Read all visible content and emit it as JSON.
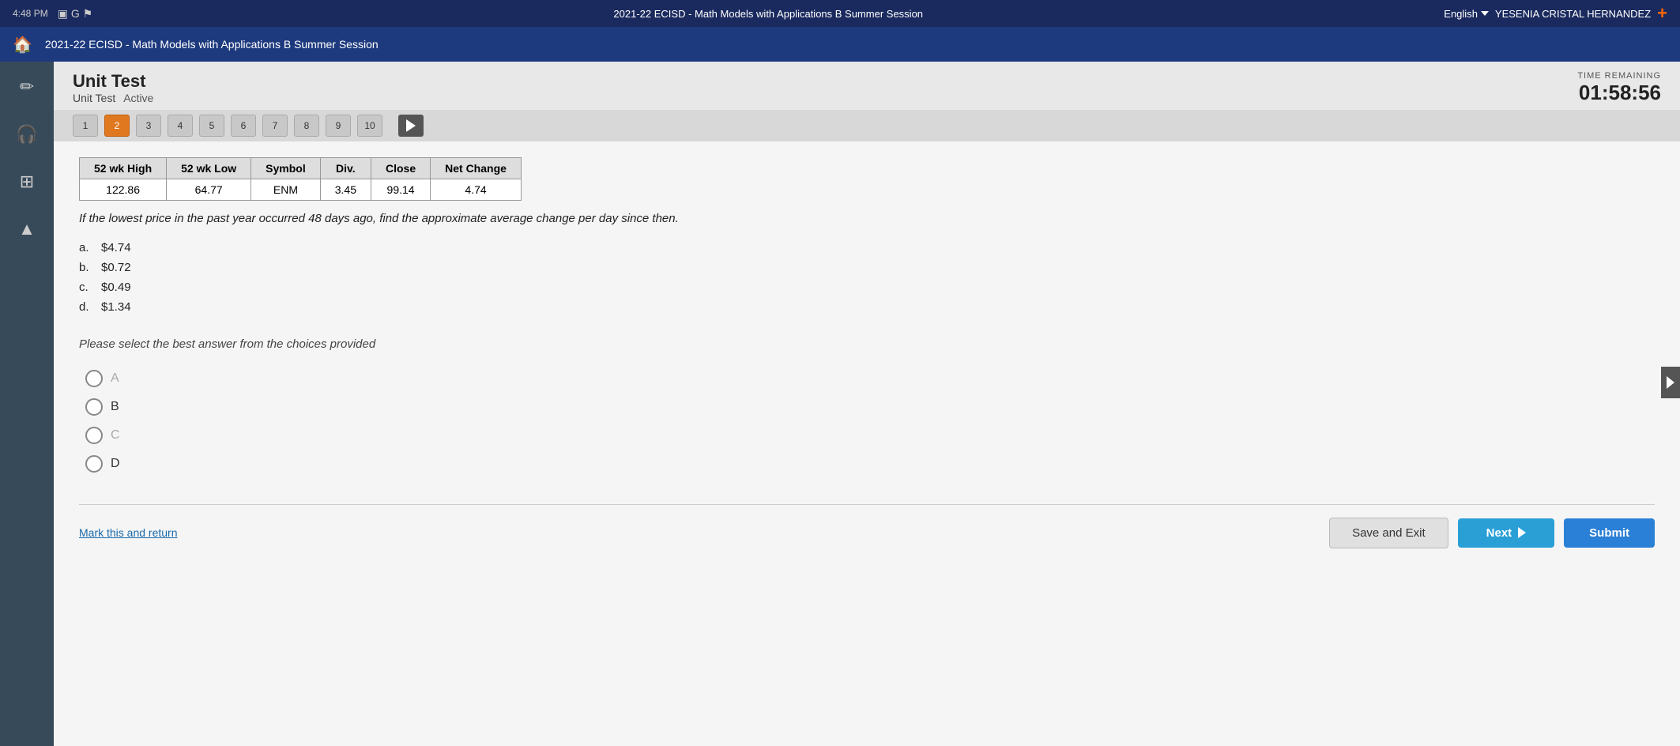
{
  "topbar": {
    "time": "4:48 PM",
    "course": "2021-22 ECISD - Math Models with Applications B Summer Session",
    "language": "English",
    "user": "YESENIA CRISTAL HERNANDEZ",
    "plus_label": "+"
  },
  "header": {
    "test_title": "Unit Test",
    "test_subtitle": "Unit Test",
    "status": "Active",
    "time_remaining_label": "TIME REMAINING",
    "time_remaining": "01:58:56"
  },
  "question_nav": {
    "questions": [
      "1",
      "2",
      "3",
      "4",
      "5",
      "6",
      "7",
      "8",
      "9",
      "10"
    ],
    "active_question": "2",
    "play_label": "▶"
  },
  "stock_table": {
    "headers": [
      "52 wk High",
      "52 wk Low",
      "Symbol",
      "Div.",
      "Close",
      "Net Change"
    ],
    "rows": [
      [
        "122.86",
        "64.77",
        "ENM",
        "3.45",
        "99.14",
        "4.74"
      ]
    ]
  },
  "question": {
    "text": "If the lowest price in the past year occurred 48 days ago, find the approximate average change per day since then.",
    "choices": [
      {
        "letter": "a.",
        "value": "$4.74"
      },
      {
        "letter": "b.",
        "value": "$0.72"
      },
      {
        "letter": "c.",
        "value": "$0.49"
      },
      {
        "letter": "d.",
        "value": "$1.34"
      }
    ]
  },
  "please_select": "Please select the best answer from the choices provided",
  "radio_options": [
    {
      "label": "A",
      "id": "radio-a"
    },
    {
      "label": "B",
      "id": "radio-b"
    },
    {
      "label": "C",
      "id": "radio-c"
    },
    {
      "label": "D",
      "id": "radio-d"
    }
  ],
  "buttons": {
    "save_exit": "Save and Exit",
    "next": "Next",
    "submit": "Submit"
  },
  "mark_return": "Mark this and return",
  "sidebar_icons": {
    "pencil": "✏",
    "headphones": "🎧",
    "grid": "⊞",
    "up_arrow": "▲"
  }
}
